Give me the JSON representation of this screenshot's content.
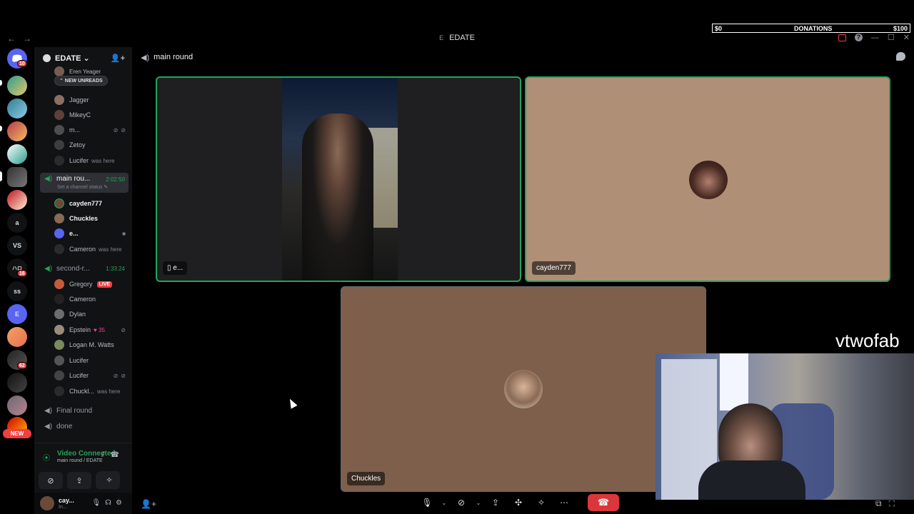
{
  "titlebar": {
    "back": "←",
    "forward": "→",
    "server_title": "EDATE",
    "server_glyph": "E"
  },
  "donations": {
    "left": "$0",
    "label": "DONATIONS",
    "right": "$100"
  },
  "rail": {
    "badges": [
      "10",
      "16",
      "62"
    ],
    "text_servers": [
      "a",
      "VS",
      "ss",
      "E"
    ],
    "new_label": "NEW"
  },
  "sidebar": {
    "server_name": "EDATE ⌄",
    "new_unreads": "⌃ NEW UNREADS",
    "top_users": [
      {
        "name": "Eren Yeager"
      },
      {
        "name": "Jagger"
      },
      {
        "name": "MikeyC"
      },
      {
        "name": "m..."
      },
      {
        "name": "Zetoy"
      },
      {
        "name": "Lucifer",
        "note": "was here"
      }
    ],
    "channels": [
      {
        "name": "main rou...",
        "timer": "2:02:50",
        "sub": "Set a channel status ✎"
      },
      {
        "name": "second-r...",
        "timer": "1:33:24"
      },
      {
        "name": "Final round"
      },
      {
        "name": "done"
      }
    ],
    "main_users": [
      {
        "name": "cayden777"
      },
      {
        "name": "Chuckles"
      },
      {
        "name": "e..."
      },
      {
        "name": "Cameron",
        "note": "was here"
      }
    ],
    "second_users": [
      {
        "name": "Gregory",
        "live": "LIVE"
      },
      {
        "name": "Cameron"
      },
      {
        "name": "Dylan"
      },
      {
        "name": "Epstein",
        "extra": "♥ 35"
      },
      {
        "name": "Logan M. Watts"
      },
      {
        "name": "Lucifer"
      },
      {
        "name": "Lucifer"
      },
      {
        "name": "Chuckl...",
        "note": "was here"
      }
    ]
  },
  "voice": {
    "status": "Video Connected",
    "location": "main round / EDATE"
  },
  "user_panel": {
    "name": "cay...",
    "sub": "In..."
  },
  "stage": {
    "channel": "main round",
    "tiles": {
      "e": "e...",
      "cayden": "cayden777",
      "chuckles": "Chuckles"
    }
  },
  "overlay": {
    "streamer_name": "vtwofab"
  }
}
